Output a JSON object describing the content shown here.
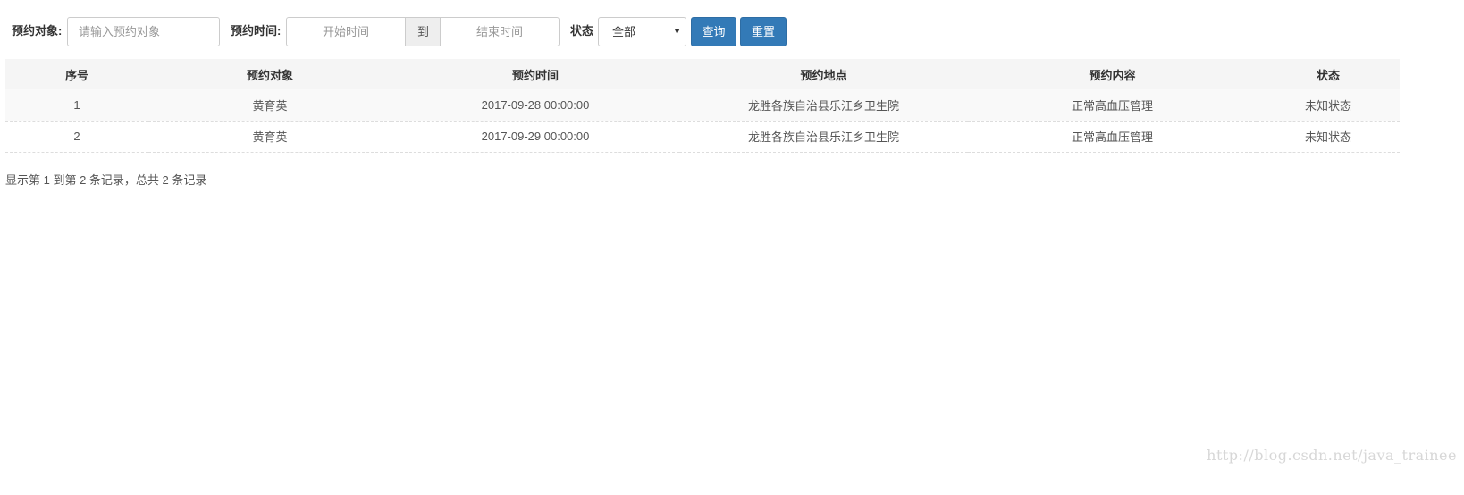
{
  "filters": {
    "target_label": "预约对象:",
    "target_placeholder": "请输入预约对象",
    "time_label": "预约时间:",
    "start_placeholder": "开始时间",
    "to_label": "到",
    "end_placeholder": "结束时间",
    "status_label": "状态",
    "status_selected": "全部",
    "query_button": "查询",
    "reset_button": "重置"
  },
  "table": {
    "headers": [
      "序号",
      "预约对象",
      "预约时间",
      "预约地点",
      "预约内容",
      "状态"
    ],
    "rows": [
      [
        "1",
        "黄育英",
        "2017-09-28 00:00:00",
        "龙胜各族自治县乐江乡卫生院",
        "正常高血压管理",
        "未知状态"
      ],
      [
        "2",
        "黄育英",
        "2017-09-29 00:00:00",
        "龙胜各族自治县乐江乡卫生院",
        "正常高血压管理",
        "未知状态"
      ]
    ]
  },
  "pagination": {
    "info": "显示第 1 到第 2 条记录，总共 2 条记录"
  },
  "watermark": "http://blog.csdn.net/java_trainee"
}
